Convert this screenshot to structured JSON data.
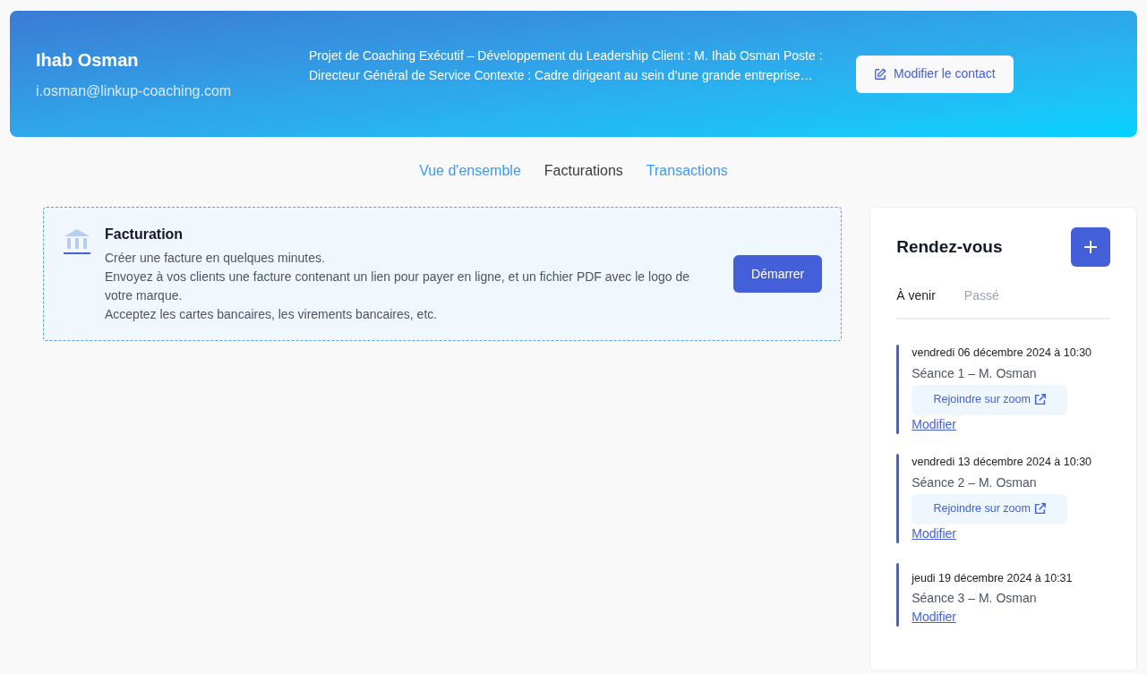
{
  "contact": {
    "name": "Ihab Osman",
    "email": "i.osman@linkup-coaching.com",
    "description": "Projet de Coaching Exécutif – Développement du Leadership Client : M. Ihab Osman Poste : Directeur Général de Service Contexte : Cadre dirigeant au sein d’une grande entreprise…",
    "edit_button": "Modifier le contact"
  },
  "tabs": [
    {
      "label": "Vue d'ensemble",
      "selected": false
    },
    {
      "label": "Facturations",
      "selected": true
    },
    {
      "label": "Transactions",
      "selected": false
    }
  ],
  "billing": {
    "title": "Facturation",
    "lines": [
      "Créer une facture en quelques minutes.",
      "Envoyez à vos clients une facture contenant un lien pour payer en ligne, et un fichier PDF avec le logo de votre marque.",
      "Acceptez les cartes bancaires, les virements bancaires, etc."
    ],
    "button": "Démarrer"
  },
  "appointments": {
    "title": "Rendez-vous",
    "tabs": [
      {
        "label": "À venir",
        "selected": true
      },
      {
        "label": "Passé",
        "selected": false
      }
    ],
    "items": [
      {
        "date": "vendredi 06 décembre 2024 à 10:30",
        "title": "Séance 1 – M. Osman",
        "join": "Rejoindre sur zoom",
        "edit": "Modifier"
      },
      {
        "date": "vendredi 13 décembre 2024 à 10:30",
        "title": "Séance 2 – M. Osman",
        "join": "Rejoindre sur zoom",
        "edit": "Modifier"
      },
      {
        "date": "jeudi 19 décembre 2024 à 10:31",
        "title": "Séance 3 – M. Osman",
        "edit": "Modifier"
      }
    ]
  }
}
